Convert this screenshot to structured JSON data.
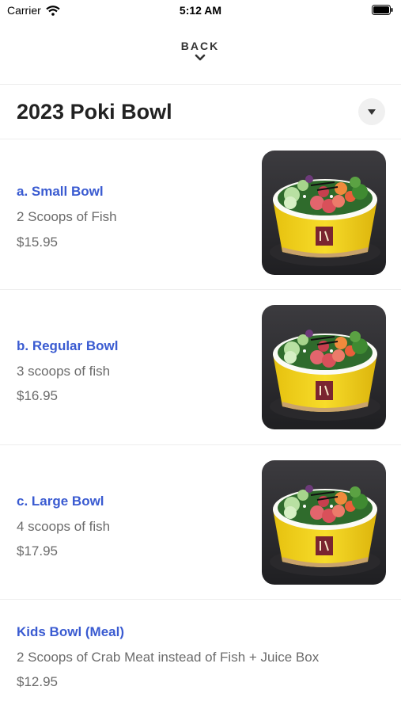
{
  "status_bar": {
    "carrier": "Carrier",
    "time": "5:12 AM"
  },
  "nav": {
    "back_label": "BACK"
  },
  "category": {
    "title": "2023 Poki Bowl"
  },
  "items": [
    {
      "name": "a. Small Bowl",
      "description": "2 Scoops of Fish",
      "price": "$15.95",
      "image": "poke-bowl-photo"
    },
    {
      "name": "b. Regular Bowl",
      "description": "3 scoops of fish",
      "price": "$16.95",
      "image": "poke-bowl-photo"
    },
    {
      "name": "c. Large Bowl",
      "description": "4 scoops of fish",
      "price": "$17.95",
      "image": "poke-bowl-photo"
    },
    {
      "name": "Kids Bowl (Meal)",
      "description": "2 Scoops of Crab Meat instead of Fish + Juice Box",
      "price": "$12.95"
    }
  ],
  "colors": {
    "item_name": "#3a5bd1",
    "secondary_text": "#6b6b6b",
    "bowl": "#f2d21b"
  }
}
